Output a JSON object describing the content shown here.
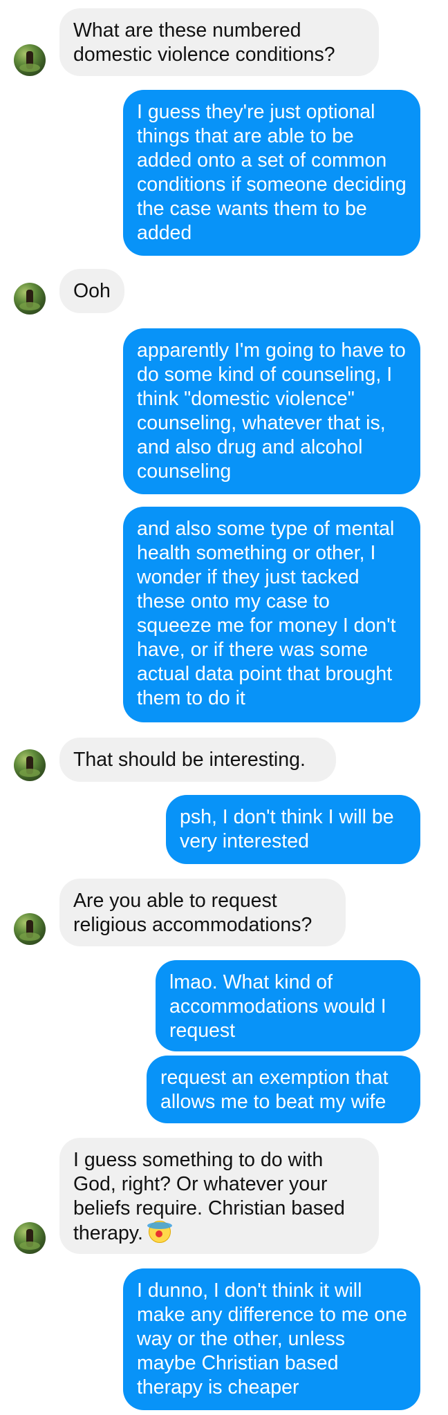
{
  "conversation": {
    "messages": [
      {
        "side": "in",
        "text": "What are these numbered domestic violence conditions?"
      },
      {
        "side": "out",
        "text": "I guess they're just optional things that are able to be added onto a set of common conditions if someone deciding the case wants them to be added"
      },
      {
        "side": "in",
        "text": "Ooh"
      },
      {
        "side": "out",
        "text": "apparently I'm going to have to do some kind of counseling, I think \"domestic violence\" counseling, whatever that is, and also drug and alcohol counseling"
      },
      {
        "side": "out",
        "text": "and also some type of mental health something or other, I wonder if they just tacked these onto my case to squeeze me for money I don't have, or if there was some actual data point that brought them to do it"
      },
      {
        "side": "in",
        "text": "That should be interesting."
      },
      {
        "side": "out",
        "text": "psh, I don't think I will be very interested"
      },
      {
        "side": "in",
        "text": "Are you able to request religious accommodations?"
      },
      {
        "side": "out",
        "text": "lmao. What kind of accommodations would I request"
      },
      {
        "side": "out",
        "text": "request an exemption that allows me to beat my wife"
      },
      {
        "side": "in",
        "text": "I guess something to do with God, right? Or whatever your beliefs require. Christian based therapy.",
        "emoji": "clown-face"
      },
      {
        "side": "out",
        "text": "I dunno, I don't think it will make any difference to me one way or the other, unless maybe Christian based therapy is cheaper"
      }
    ]
  },
  "colors": {
    "incoming_bubble": "#f0f0f0",
    "outgoing_bubble": "#0893f8",
    "incoming_text": "#111111",
    "outgoing_text": "#ffffff"
  }
}
